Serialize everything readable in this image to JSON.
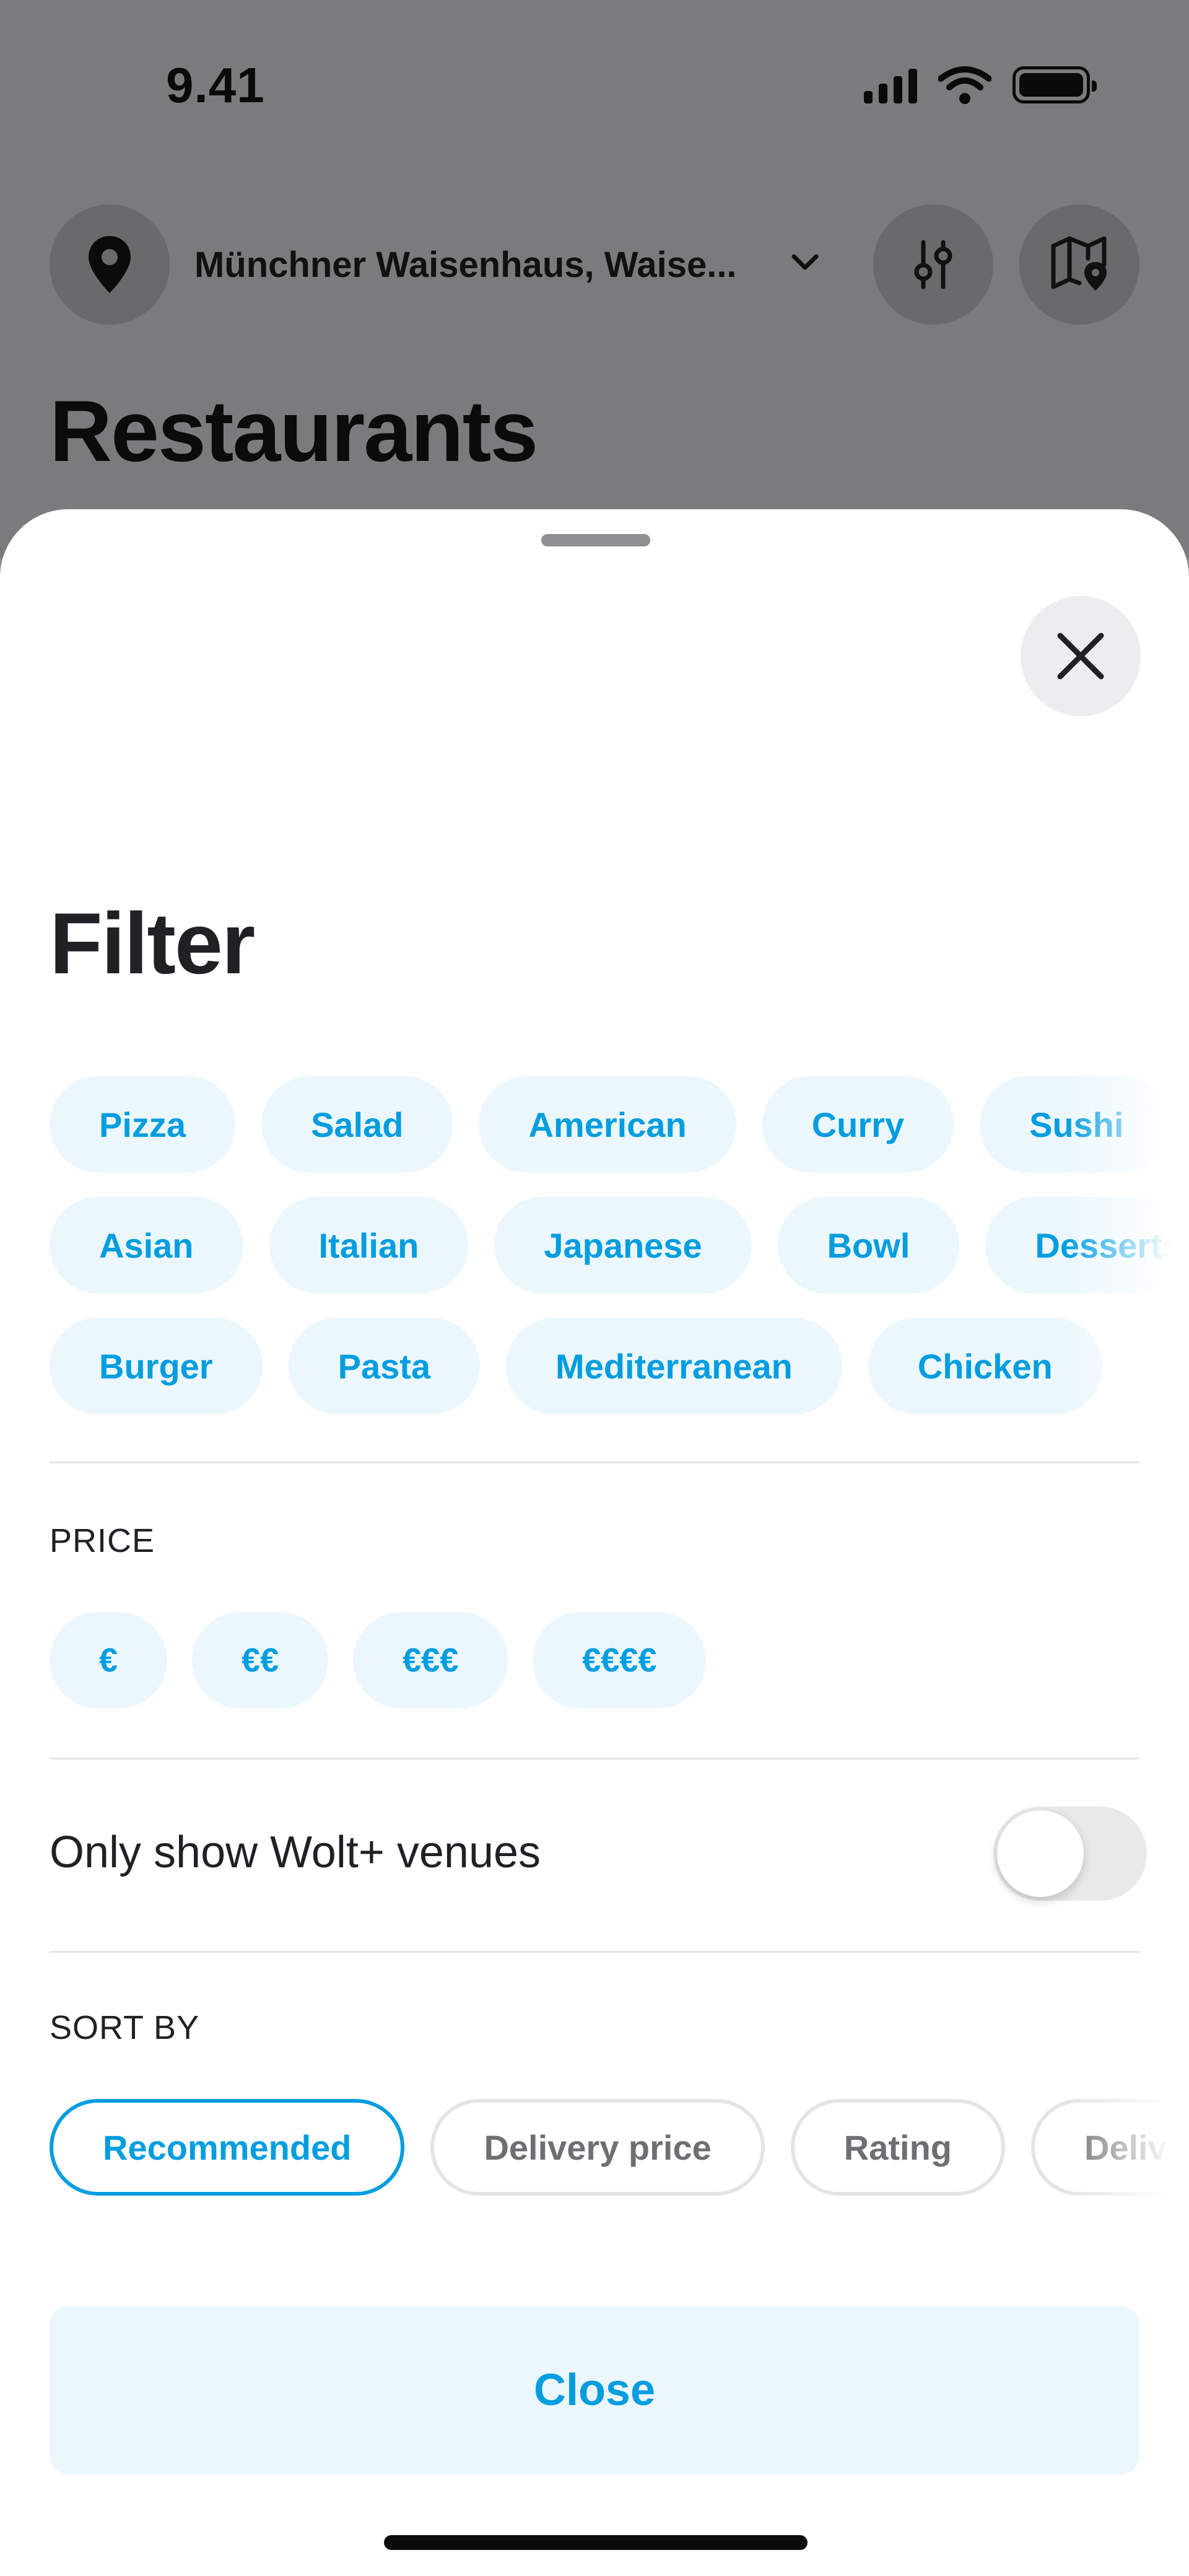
{
  "status_bar": {
    "time": "9.41"
  },
  "background": {
    "location_label": "Münchner Waisenhaus, Waise...",
    "page_title": "Restaurants"
  },
  "sheet": {
    "title": "Filter",
    "categories": {
      "row1": [
        "Pizza",
        "Salad",
        "American",
        "Curry",
        "Sushi"
      ],
      "row2": [
        "Asian",
        "Italian",
        "Japanese",
        "Bowl",
        "Desserts"
      ],
      "row3": [
        "Burger",
        "Pasta",
        "Mediterranean",
        "Chicken"
      ]
    },
    "price": {
      "label": "PRICE",
      "options": [
        "€",
        "€€",
        "€€€",
        "€€€€"
      ]
    },
    "wolt_plus": {
      "label": "Only show Wolt+ venues",
      "enabled": false
    },
    "sort": {
      "label": "SORT BY",
      "options": [
        "Recommended",
        "Delivery price",
        "Rating",
        "Delivery time"
      ],
      "selected": "Recommended"
    },
    "close_label": "Close"
  },
  "colors": {
    "accent": "#009de0",
    "chip_bg": "#ebf7fd",
    "text": "#202125"
  }
}
